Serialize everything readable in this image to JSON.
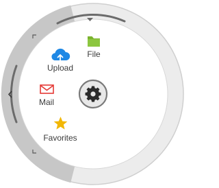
{
  "menu": {
    "center": {
      "icon": "gear-icon"
    },
    "items": [
      {
        "id": "file",
        "label": "File",
        "icon": "folder-icon",
        "color": "#7BB32E"
      },
      {
        "id": "upload",
        "label": "Upload",
        "icon": "cloud-upload-icon",
        "color": "#1E88E5"
      },
      {
        "id": "mail",
        "label": "Mail",
        "icon": "envelope-icon",
        "color": "#E53935"
      },
      {
        "id": "favorites",
        "label": "Favorites",
        "icon": "star-icon",
        "color": "#F2B705"
      }
    ],
    "colors": {
      "outer_ring": "#ECECEC",
      "ring_border": "#CFCFCF",
      "left_segment": "#C7C7C7",
      "inner_panel": "#FFFFFF",
      "accent_arc": "#6B6B6B",
      "gear_button": "#E6E6E6",
      "gear": "#2B2B2B",
      "text": "#3A3A3A"
    }
  }
}
